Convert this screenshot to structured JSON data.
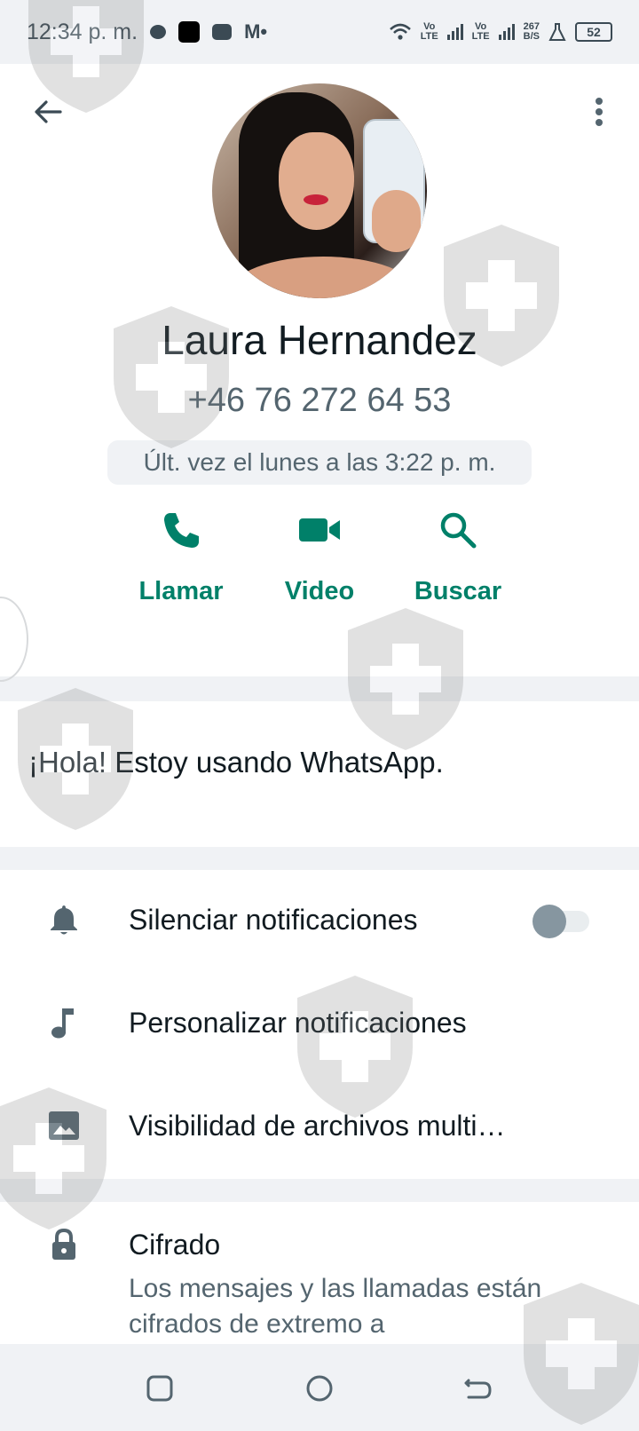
{
  "status_bar": {
    "time": "12:34 p. m.",
    "net1_top": "Vo",
    "net1_bottom": "LTE",
    "net2_top": "Vo",
    "net2_bottom": "LTE",
    "speed_value": "267",
    "speed_unit": "B/S",
    "battery": "52"
  },
  "contact": {
    "name": "Laura Hernandez",
    "phone": "+46 76 272 64 53",
    "last_seen": "Últ. vez el lunes a las 3:22 p. m."
  },
  "actions": [
    {
      "label": "Llamar",
      "icon": "phone-icon"
    },
    {
      "label": "Video",
      "icon": "video-icon"
    },
    {
      "label": "Buscar",
      "icon": "search-icon"
    }
  ],
  "about": "¡Hola! Estoy usando WhatsApp.",
  "settings": [
    {
      "label": "Silenciar notificaciones",
      "icon": "bell-icon",
      "toggle": false
    },
    {
      "label": "Personalizar notificaciones",
      "icon": "music-note-icon"
    },
    {
      "label": "Visibilidad de archivos multi…",
      "icon": "image-icon"
    }
  ],
  "encryption": {
    "title": "Cifrado",
    "description": "Los mensajes y las llamadas están cifrados de extremo a"
  },
  "colors": {
    "accent": "#008069",
    "text_primary": "#111b21",
    "text_secondary": "#54656f",
    "background": "#f0f2f5",
    "card": "#ffffff"
  }
}
